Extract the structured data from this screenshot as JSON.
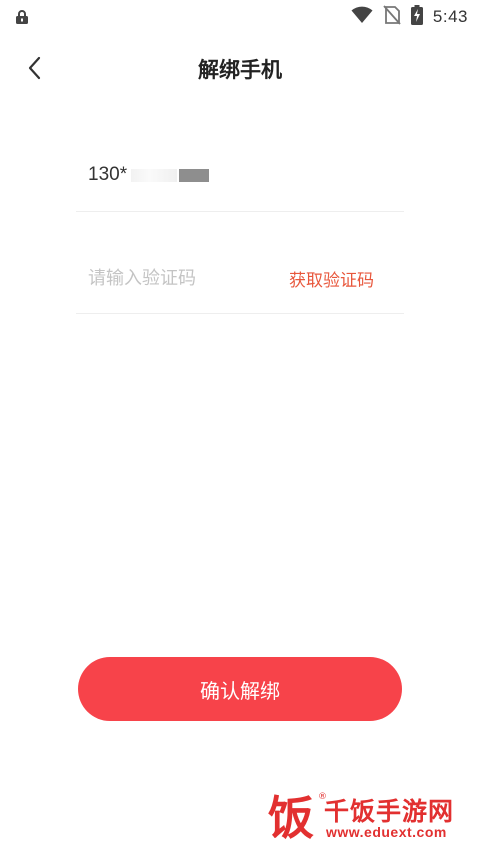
{
  "status_bar": {
    "time": "5:43",
    "icons": [
      "lock-icon",
      "wifi-icon",
      "no-sim-icon",
      "battery-charging-icon"
    ]
  },
  "header": {
    "title": "解绑手机",
    "back_icon": "chevron-left-icon"
  },
  "form": {
    "phone_prefix": "130*",
    "code_placeholder": "请输入验证码",
    "code_value": "",
    "get_code_label": "获取验证码"
  },
  "confirm": {
    "label": "确认解绑"
  },
  "watermark": {
    "logo_char": "饭",
    "site_name": "千饭手游网",
    "url": "www.eduext.com"
  },
  "colors": {
    "accent": "#f7434a",
    "link": "#e8573c",
    "watermark": "#e23030",
    "placeholder": "#c4c4c4"
  }
}
